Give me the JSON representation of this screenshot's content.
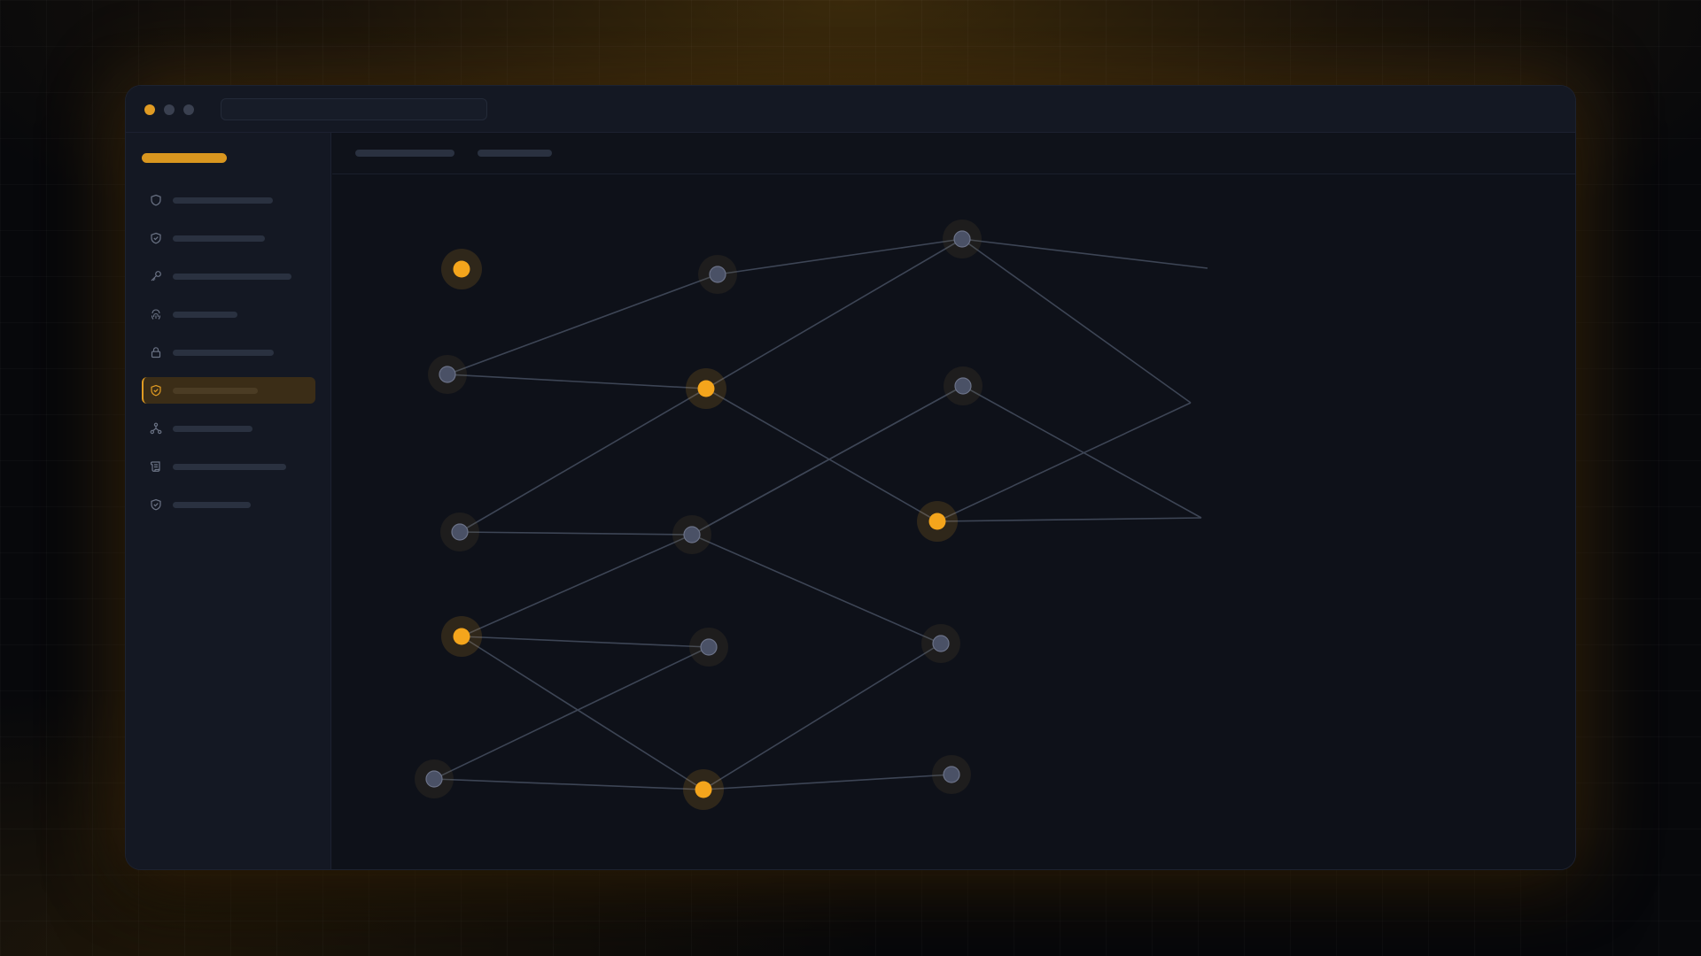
{
  "window": {
    "traffic_light_colors": [
      "#e09b23",
      "#3a4050",
      "#3a4050"
    ],
    "address_bar_text": ""
  },
  "sidebar": {
    "brand_label": "",
    "items": [
      {
        "icon": "shield-icon",
        "label": "",
        "active": false
      },
      {
        "icon": "shield-check-icon",
        "label": "",
        "active": false
      },
      {
        "icon": "key-icon",
        "label": "",
        "active": false
      },
      {
        "icon": "fingerprint-icon",
        "label": "",
        "active": false
      },
      {
        "icon": "lock-icon",
        "label": "",
        "active": false
      },
      {
        "icon": "shield-check-icon",
        "label": "",
        "active": true
      },
      {
        "icon": "network-icon",
        "label": "",
        "active": false
      },
      {
        "icon": "scroll-icon",
        "label": "",
        "active": false
      },
      {
        "icon": "shield-check-icon",
        "label": "",
        "active": false
      }
    ]
  },
  "toolbar": {
    "tabs": [
      {
        "label": ""
      },
      {
        "label": ""
      }
    ]
  },
  "graph": {
    "colors": {
      "node_active": "#f4a51c",
      "node_idle": "#4a5166",
      "edge": "#3d4555",
      "accent": "#e09b23"
    },
    "nodes": [
      {
        "id": "n1",
        "active": true
      },
      {
        "id": "n2",
        "active": false
      },
      {
        "id": "n3",
        "active": false
      },
      {
        "id": "n4",
        "active": false
      },
      {
        "id": "n5",
        "active": true
      },
      {
        "id": "n6",
        "active": false
      },
      {
        "id": "n7",
        "active": false
      },
      {
        "id": "n8",
        "active": false
      },
      {
        "id": "n9",
        "active": true
      },
      {
        "id": "n10",
        "active": true
      },
      {
        "id": "n11",
        "active": false
      },
      {
        "id": "n12",
        "active": false
      },
      {
        "id": "n13",
        "active": false
      },
      {
        "id": "n14",
        "active": true
      },
      {
        "id": "n15",
        "active": false
      }
    ],
    "edges": [
      [
        "n2",
        "n3"
      ],
      [
        "n3",
        "w1"
      ],
      [
        "n3",
        "w2"
      ],
      [
        "n2",
        "n4"
      ],
      [
        "n4",
        "n5"
      ],
      [
        "n5",
        "n3"
      ],
      [
        "n5",
        "n9"
      ],
      [
        "n5",
        "n7"
      ],
      [
        "n6",
        "n8"
      ],
      [
        "n6",
        "w3"
      ],
      [
        "n7",
        "n8"
      ],
      [
        "n8",
        "n6"
      ],
      [
        "n8",
        "n12"
      ],
      [
        "n8",
        "n10"
      ],
      [
        "n9",
        "w3"
      ],
      [
        "n9",
        "w2"
      ],
      [
        "n10",
        "n11"
      ],
      [
        "n10",
        "n14"
      ],
      [
        "n11",
        "n13"
      ],
      [
        "n13",
        "n14"
      ],
      [
        "n14",
        "n12"
      ],
      [
        "n14",
        "n15"
      ]
    ]
  }
}
